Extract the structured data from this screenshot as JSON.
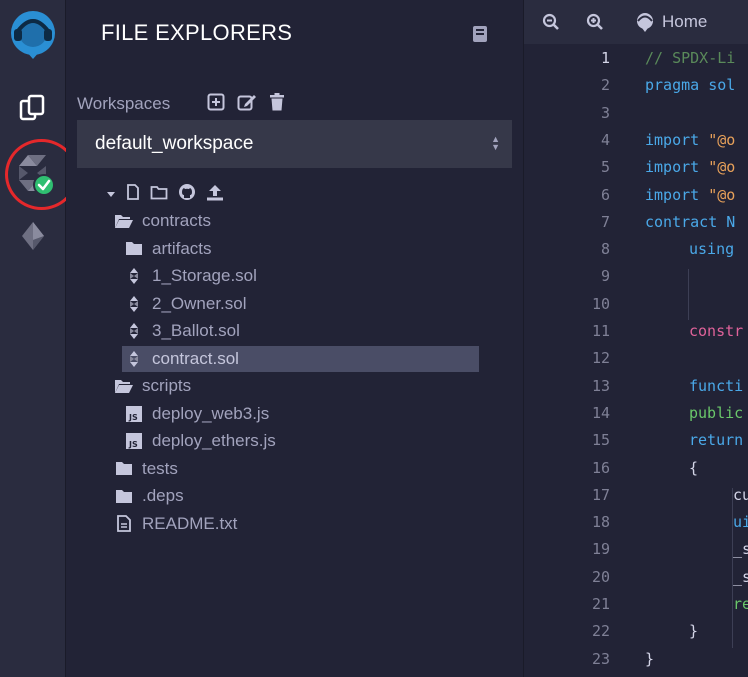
{
  "explorer": {
    "title": "FILE EXPLORERS",
    "workspaces_label": "Workspaces",
    "workspace_selected": "default_workspace",
    "tree": [
      {
        "label": "contracts",
        "kind": "folder-open",
        "depth": 0
      },
      {
        "label": "artifacts",
        "kind": "folder",
        "depth": 1
      },
      {
        "label": "1_Storage.sol",
        "kind": "solidity",
        "depth": 1
      },
      {
        "label": "2_Owner.sol",
        "kind": "solidity",
        "depth": 1
      },
      {
        "label": "3_Ballot.sol",
        "kind": "solidity",
        "depth": 1
      },
      {
        "label": "contract.sol",
        "kind": "solidity",
        "depth": 1,
        "selected": true
      },
      {
        "label": "scripts",
        "kind": "folder-open",
        "depth": 0
      },
      {
        "label": "deploy_web3.js",
        "kind": "js",
        "depth": 1
      },
      {
        "label": "deploy_ethers.js",
        "kind": "js",
        "depth": 1
      },
      {
        "label": "tests",
        "kind": "folder",
        "depth": 0
      },
      {
        "label": ".deps",
        "kind": "folder",
        "depth": 0
      },
      {
        "label": "README.txt",
        "kind": "file",
        "depth": 0
      }
    ]
  },
  "editor": {
    "home_tab": "Home",
    "line_numbers": [
      "1",
      "2",
      "3",
      "4",
      "5",
      "6",
      "7",
      "8",
      "9",
      "10",
      "11",
      "12",
      "13",
      "14",
      "15",
      "16",
      "17",
      "18",
      "19",
      "20",
      "21",
      "22",
      "23"
    ],
    "code_lines": [
      {
        "text": "// SPDX-Li",
        "color": "#5a8a5a",
        "indent": 0
      },
      {
        "text": "pragma sol",
        "color": "#4aa8e8",
        "indent": 0
      },
      {
        "text": "",
        "color": "#c5c6dc",
        "indent": 0
      },
      {
        "text": "import \"@o",
        "color": "#4aa8e8",
        "indent": 0,
        "accent": "#e8a15a",
        "split": 7
      },
      {
        "text": "import \"@o",
        "color": "#4aa8e8",
        "indent": 0,
        "accent": "#e8a15a",
        "split": 7
      },
      {
        "text": "import \"@o",
        "color": "#4aa8e8",
        "indent": 0,
        "accent": "#e8a15a",
        "split": 7
      },
      {
        "text": "contract N",
        "color": "#4aa8e8",
        "indent": 0
      },
      {
        "text": "using",
        "color": "#4aa8e8",
        "indent": 1
      },
      {
        "text": "",
        "color": "#c5c6dc",
        "indent": 2
      },
      {
        "text": "",
        "color": "#c5c6dc",
        "indent": 0
      },
      {
        "text": "constr",
        "color": "#e0629a",
        "indent": 1
      },
      {
        "text": "",
        "color": "#c5c6dc",
        "indent": 0
      },
      {
        "text": "functi",
        "color": "#4aa8e8",
        "indent": 1
      },
      {
        "text": "public",
        "color": "#6ac76a",
        "indent": 1
      },
      {
        "text": "return",
        "color": "#4aa8e8",
        "indent": 1
      },
      {
        "text": "{",
        "color": "#d4d5e8",
        "indent": 1
      },
      {
        "text": "cu",
        "color": "#d4d5e8",
        "indent": 2
      },
      {
        "text": "ui",
        "color": "#4aa8e8",
        "indent": 2
      },
      {
        "text": "_s",
        "color": "#d4d5e8",
        "indent": 2
      },
      {
        "text": "_s",
        "color": "#d4d5e8",
        "indent": 2
      },
      {
        "text": "re",
        "color": "#6ac76a",
        "indent": 2
      },
      {
        "text": "}",
        "color": "#d4d5e8",
        "indent": 1
      },
      {
        "text": "}",
        "color": "#d4d5e8",
        "indent": 0
      }
    ]
  },
  "icons": {
    "rail": [
      "remix-logo-icon",
      "file-explorer-icon",
      "solidity-compiler-icon",
      "deploy-run-icon"
    ],
    "workspace": [
      "add-workspace-icon",
      "rename-workspace-icon",
      "delete-workspace-icon"
    ],
    "tree_toolbar": [
      "collapse-caret-icon",
      "new-file-icon",
      "new-folder-icon",
      "github-icon",
      "upload-icon"
    ]
  },
  "colors": {
    "highlight_circle": "#e5282b",
    "check_badge": "#2fbf71",
    "accent_blue": "#2a8fd4"
  }
}
